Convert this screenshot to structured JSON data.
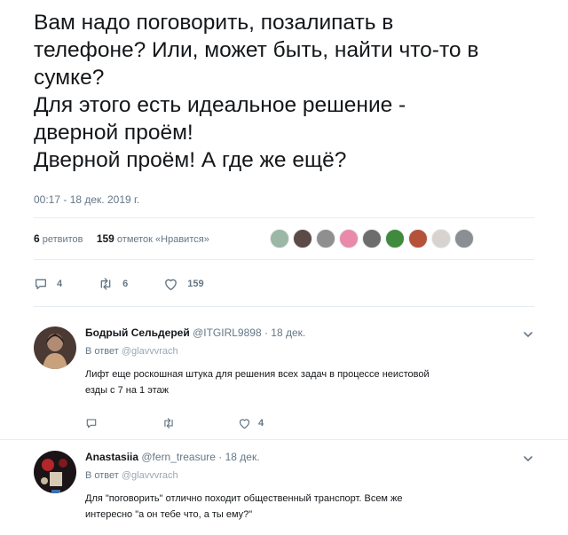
{
  "tweet": {
    "lines": [
      "Вам надо поговорить, позалипать в",
      "телефоне? Или, может быть, найти что-то в",
      "сумке?",
      "Для этого есть идеальное решение -",
      "дверной проём!",
      "Дверной проём! А где же ещё?"
    ],
    "timestamp": "00:17 - 18 дек. 2019 г."
  },
  "stats": {
    "retweets_count": "6",
    "retweets_label": "ретвитов",
    "likes_count": "159",
    "likes_label": "отметок «Нравится»"
  },
  "likers": [
    "#9bb7a6",
    "#5c4a46",
    "#8f8f8f",
    "#e98aa8",
    "#6d6d6d",
    "#3f8a3c",
    "#b5533a",
    "#d9d3cf",
    "#8b8e93"
  ],
  "actions": {
    "reply_count": "4",
    "retweet_count": "6",
    "like_count": "159"
  },
  "replies": [
    {
      "name": "Бодрый Сельдерей",
      "handle": "@ITGIRL9898 · 18 дек.",
      "reply_to_label": "В ответ",
      "reply_to_handle": "@glavvvrach",
      "text_lines": [
        "Лифт еще роскошная штука для решения всех задач в процессе неистовой",
        "езды с 7 на 1 этаж"
      ],
      "like_count": "4"
    },
    {
      "name": "Anastasiia",
      "handle": "@fern_treasure · 18 дек.",
      "reply_to_label": "В ответ",
      "reply_to_handle": "@glavvvrach",
      "text_lines": [
        "Для \"поговорить\" отлично походит общественный транспорт. Всем же",
        "интересно \"а он тебе что, а ты ему?\""
      ]
    }
  ],
  "colors": {
    "text": "#14171a",
    "muted": "#657786",
    "separator": "#e6ecf0",
    "mention": "#99a8b5"
  }
}
